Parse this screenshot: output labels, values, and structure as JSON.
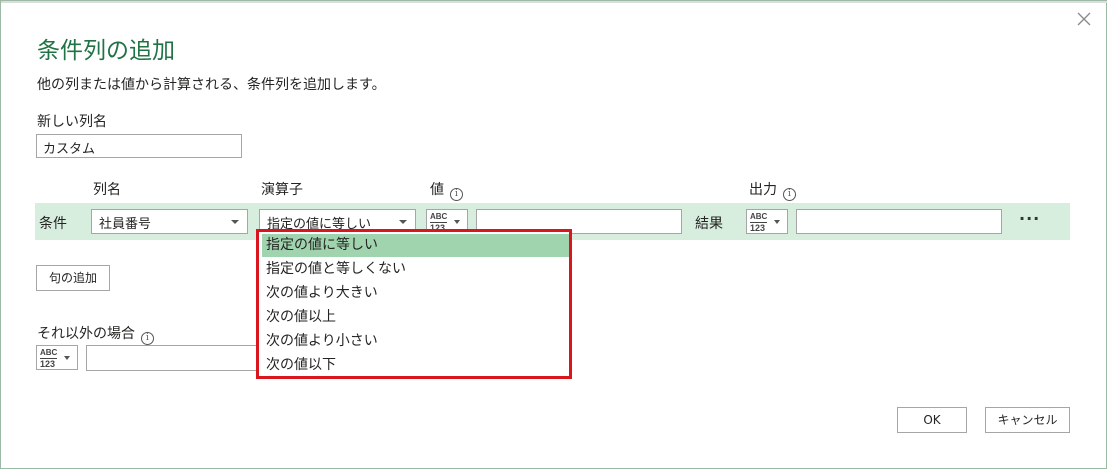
{
  "dialog": {
    "title": "条件列の追加",
    "description": "他の列または値から計算される、条件列を追加します。",
    "close_icon": "close-icon"
  },
  "new_column": {
    "label": "新しい列名",
    "value": "カスタム"
  },
  "headers": {
    "column_name": "列名",
    "operator": "演算子",
    "value": "値",
    "output": "出力"
  },
  "condition": {
    "label": "条件",
    "column": "社員番号",
    "operator": "指定の値に等しい",
    "value_type": {
      "abc": "ABC",
      "num": "123"
    },
    "value": "",
    "result_label": "結果",
    "output_type": {
      "abc": "ABC",
      "num": "123"
    },
    "output_value": "",
    "more": "···"
  },
  "add_clause_label": "句の追加",
  "else": {
    "label": "それ以外の場合",
    "type": {
      "abc": "ABC",
      "num": "123"
    },
    "value": ""
  },
  "operator_options": [
    "指定の値に等しい",
    "指定の値と等しくない",
    "次の値より大きい",
    "次の値以上",
    "次の値より小さい",
    "次の値以下"
  ],
  "buttons": {
    "ok": "OK",
    "cancel": "キャンセル"
  },
  "colors": {
    "title": "#217346",
    "row_bg": "#d7eedf",
    "selected_option": "#a0d4ae",
    "highlight_border": "#d9161e"
  }
}
